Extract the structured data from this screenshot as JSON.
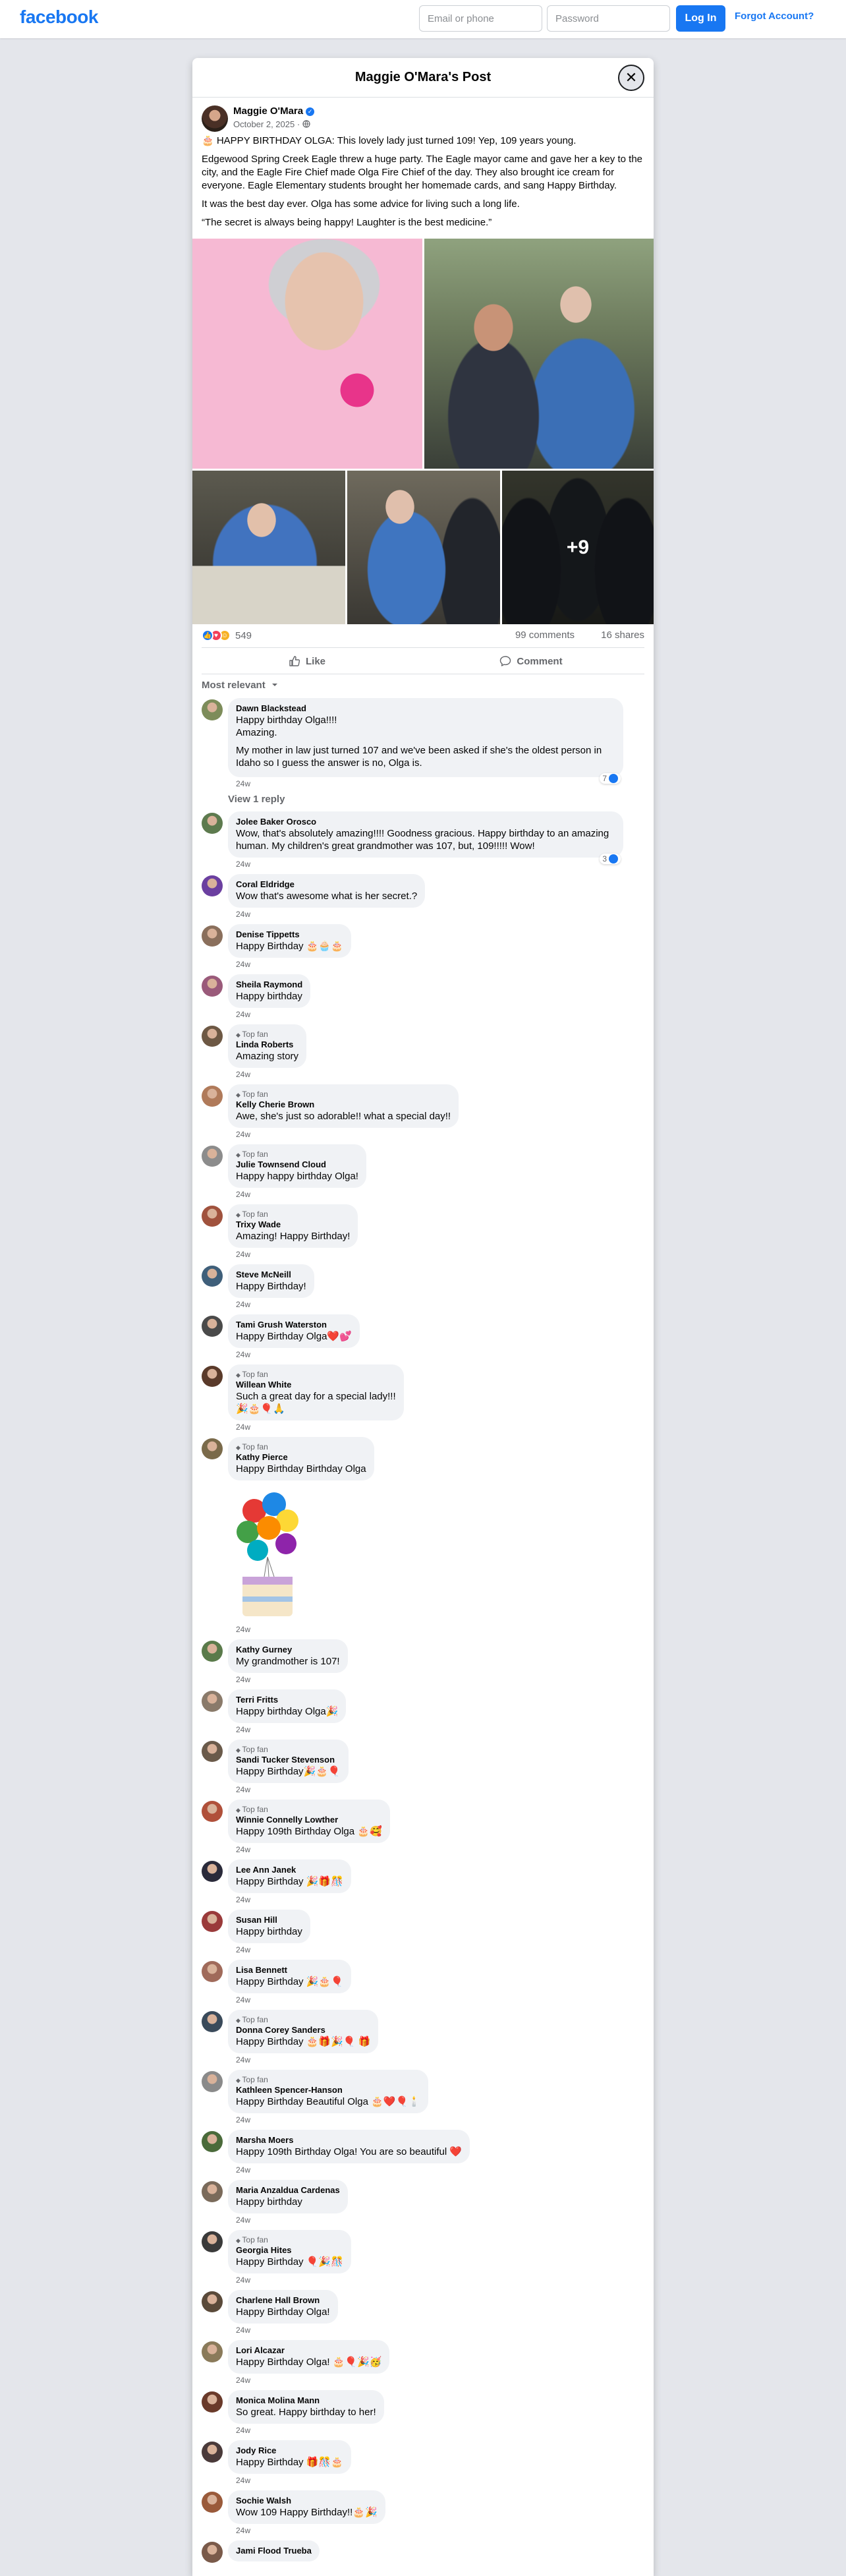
{
  "topbar": {
    "logo": "facebook",
    "email_placeholder": "Email or phone",
    "password_placeholder": "Password",
    "login_label": "Log In",
    "forgot_label": "Forgot Account?"
  },
  "dialog": {
    "title": "Maggie O'Mara's Post",
    "close_icon": "close-icon"
  },
  "post": {
    "author": "Maggie O'Mara",
    "date": "October 2, 2025 · ",
    "paragraphs": [
      "🎂 HAPPY BIRTHDAY OLGA: This lovely lady just turned 109! Yep, 109 years young.",
      "Edgewood Spring Creek Eagle threw a huge party. The Eagle mayor came and gave her a key to the city, and the Eagle Fire Chief made Olga Fire Chief of the day. They also brought ice cream for everyone. Eagle Elementary students brought her homemade cards, and sang Happy Birthday.",
      "It was the best day ever. Olga has some advice for living such a long life.",
      "“The secret is always being happy! Laughter is the best medicine.”"
    ],
    "more_photos": "+9",
    "reaction_count": "549",
    "comments_count": "99 comments",
    "shares_count": "16 shares",
    "like_label": "Like",
    "comment_label": "Comment",
    "sort_label": "Most relevant"
  },
  "comments": [
    {
      "name": "Dawn Blackstead",
      "topfan": "",
      "lines": [
        "Happy birthday Olga!!!!",
        "Amazing.",
        "My mother in law just turned 107 and we've been asked if she's the oldest person in Idaho so I guess the answer is no, Olga is."
      ],
      "time": "24w",
      "reactions": "7",
      "color": "#7d8c5a"
    },
    {
      "name": "Jolee Baker Orosco",
      "topfan": "",
      "lines": [
        "Wow, that's absolutely amazing!!!! Goodness gracious. Happy birthday to an amazing human. My children's great grandmother was 107, but, 109!!!!! Wow!"
      ],
      "time": "24w",
      "reactions": "3",
      "color": "#5d7a4e"
    },
    {
      "name": "Coral Eldridge",
      "topfan": "",
      "lines": [
        "Wow that's awesome what is her secret.?"
      ],
      "time": "24w",
      "reactions": "",
      "color": "#6b3fa0"
    },
    {
      "name": "Denise Tippetts",
      "topfan": "",
      "lines": [
        "Happy Birthday 🎂🧁🎂"
      ],
      "time": "24w",
      "reactions": "",
      "color": "#8a6f5c"
    },
    {
      "name": "Sheila Raymond",
      "topfan": "",
      "lines": [
        "Happy birthday"
      ],
      "time": "24w",
      "reactions": "",
      "color": "#9a5a7a"
    },
    {
      "name": "Linda Roberts",
      "topfan": "Top fan",
      "lines": [
        "Amazing story"
      ],
      "time": "24w",
      "reactions": "",
      "color": "#6d5844"
    },
    {
      "name": "Kelly Cherie Brown",
      "topfan": "Top fan",
      "lines": [
        "Awe, she's just so adorable!! what a special day!!"
      ],
      "time": "24w",
      "reactions": "",
      "color": "#b07a5a"
    },
    {
      "name": "Julie Townsend Cloud",
      "topfan": "Top fan",
      "lines": [
        "Happy happy birthday Olga!"
      ],
      "time": "24w",
      "reactions": "",
      "color": "#8c8c8c"
    },
    {
      "name": "Trixy Wade",
      "topfan": "Top fan",
      "lines": [
        "Amazing! Happy Birthday!"
      ],
      "time": "24w",
      "reactions": "",
      "color": "#a0523d"
    },
    {
      "name": "Steve McNeill",
      "topfan": "",
      "lines": [
        "Happy Birthday!"
      ],
      "time": "24w",
      "reactions": "",
      "color": "#3f5f7a"
    },
    {
      "name": "Tami Grush Waterston",
      "topfan": "",
      "lines": [
        "Happy Birthday Olga❤️💕"
      ],
      "time": "24w",
      "reactions": "",
      "color": "#4a4a4a"
    },
    {
      "name": "Willean White",
      "topfan": "Top fan",
      "lines": [
        "Such a great day for a special lady!!!",
        "🎉🎂🎈🙏"
      ],
      "time": "24w",
      "reactions": "",
      "color": "#5a3a2a"
    },
    {
      "name": "Kathy Pierce",
      "topfan": "Top fan",
      "lines": [
        "Happy Birthday Birthday Olga"
      ],
      "time": "24w",
      "reactions": "",
      "color": "#7a6a4a",
      "sticker": "balloons-birthday-sticker"
    },
    {
      "name": "Kathy Gurney",
      "topfan": "",
      "lines": [
        "My grandmother is 107!"
      ],
      "time": "24w",
      "reactions": "",
      "color": "#5a7a4a"
    },
    {
      "name": "Terri Fritts",
      "topfan": "",
      "lines": [
        "Happy birthday Olga🎉"
      ],
      "time": "24w",
      "reactions": "",
      "color": "#8a7a6a"
    },
    {
      "name": "Sandi Tucker Stevenson",
      "topfan": "Top fan",
      "lines": [
        "Happy Birthday🎉🎂🎈"
      ],
      "time": "24w",
      "reactions": "",
      "color": "#6a5a4a"
    },
    {
      "name": "Winnie Connelly Lowther",
      "topfan": "Top fan",
      "lines": [
        "Happy 109th Birthday Olga 🎂🥰"
      ],
      "time": "24w",
      "reactions": "",
      "color": "#b0503a"
    },
    {
      "name": "Lee Ann Janek",
      "topfan": "",
      "lines": [
        "Happy Birthday 🎉🎁🎊"
      ],
      "time": "24w",
      "reactions": "",
      "color": "#2a2a3a"
    },
    {
      "name": "Susan Hill",
      "topfan": "",
      "lines": [
        "Happy birthday"
      ],
      "time": "24w",
      "reactions": "",
      "color": "#9a3a3a"
    },
    {
      "name": "Lisa Bennett",
      "topfan": "",
      "lines": [
        "Happy Birthday 🎉🎂🎈"
      ],
      "time": "24w",
      "reactions": "",
      "color": "#a06a5a"
    },
    {
      "name": "Donna Corey Sanders",
      "topfan": "Top fan",
      "lines": [
        "Happy Birthday 🎂🎁🎉🎈 🎁"
      ],
      "time": "24w",
      "reactions": "",
      "color": "#3a4a5a"
    },
    {
      "name": "Kathleen Spencer-Hanson",
      "topfan": "Top fan",
      "lines": [
        "Happy Birthday Beautiful Olga 🎂❤️🎈🕯️"
      ],
      "time": "24w",
      "reactions": "",
      "color": "#8a8a8a"
    },
    {
      "name": "Marsha Moers",
      "topfan": "",
      "lines": [
        "Happy 109th Birthday Olga! You are so beautiful ❤️"
      ],
      "time": "24w",
      "reactions": "",
      "color": "#4a6a3a"
    },
    {
      "name": "Maria Anzaldua Cardenas",
      "topfan": "",
      "lines": [
        "Happy birthday"
      ],
      "time": "24w",
      "reactions": "",
      "color": "#7a6a5a"
    },
    {
      "name": "Georgia Hites",
      "topfan": "Top fan",
      "lines": [
        "Happy Birthday 🎈🎉🎊"
      ],
      "time": "24w",
      "reactions": "",
      "color": "#3a3a3a"
    },
    {
      "name": "Charlene Hall Brown",
      "topfan": "",
      "lines": [
        "Happy Birthday Olga!"
      ],
      "time": "24w",
      "reactions": "",
      "color": "#5a4a3a"
    },
    {
      "name": "Lori Alcazar",
      "topfan": "",
      "lines": [
        "Happy Birthday Olga! 🎂🎈🎉🥳"
      ],
      "time": "24w",
      "reactions": "",
      "color": "#8a7a5a"
    },
    {
      "name": "Monica Molina Mann",
      "topfan": "",
      "lines": [
        "So great. Happy birthday to her!"
      ],
      "time": "24w",
      "reactions": "",
      "color": "#6a3a2a"
    },
    {
      "name": "Jody Rice",
      "topfan": "",
      "lines": [
        "Happy Birthday 🎁🎊🎂"
      ],
      "time": "24w",
      "reactions": "",
      "color": "#4a3a3a"
    },
    {
      "name": "Sochie Walsh",
      "topfan": "",
      "lines": [
        "Wow 109 Happy Birthday!!🎂🎉"
      ],
      "time": "24w",
      "reactions": "",
      "color": "#9a5a3a"
    },
    {
      "name": "Jami Flood Trueba",
      "topfan": "",
      "lines": [
        ""
      ],
      "time": "",
      "reactions": "",
      "color": "#7a5a4a"
    }
  ],
  "view_reply_label": "View 1 reply",
  "icons": {
    "like": "thumbs-up-icon",
    "comment": "speech-bubble-icon",
    "globe": "globe-icon",
    "verified": "verified-badge-icon",
    "dropdown": "chevron-down-icon"
  },
  "colors": {
    "brand": "#1877f2",
    "background": "#e4e6eb",
    "bubble": "#f0f2f5",
    "muted": "#65676b"
  }
}
